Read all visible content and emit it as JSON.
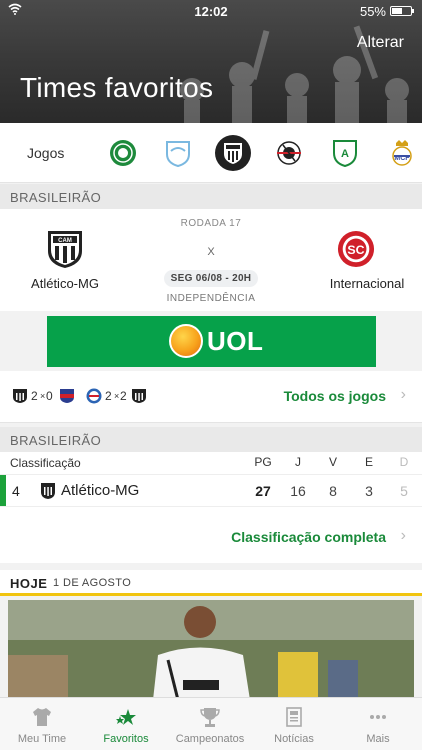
{
  "status_bar": {
    "time": "12:02",
    "battery": "55%"
  },
  "header": {
    "title": "Times favoritos",
    "edit_label": "Alterar"
  },
  "teams_row": {
    "label": "Jogos",
    "teams": [
      {
        "icon": "palmeiras-crest-icon",
        "color": "#1e8a3c"
      },
      {
        "icon": "londrina-crest-icon",
        "color": "#7ab8e0"
      },
      {
        "icon": "atletico-mg-crest-icon",
        "color": "#222222",
        "selected": true
      },
      {
        "icon": "corinthians-crest-icon",
        "color": "#d0202a"
      },
      {
        "icon": "america-mg-crest-icon",
        "color": "#1a8a3a"
      },
      {
        "icon": "real-madrid-crest-icon",
        "color": "#d4a017"
      }
    ]
  },
  "match_section": {
    "label": "BRASILEIRÃO"
  },
  "match": {
    "round": "RODADA 17",
    "vs": "X",
    "home": {
      "name": "Atlético-MG"
    },
    "away": {
      "name": "Internacional"
    },
    "datetime": "SEG 06/08 - 20H",
    "stadium": "INDEPENDÊNCIA"
  },
  "ad": {
    "brand": "UOL"
  },
  "recent_results": {
    "games": [
      {
        "home_score": "2",
        "away_score": "0",
        "sep": "×"
      },
      {
        "home_score": "2",
        "away_score": "2",
        "sep": "×"
      }
    ],
    "link_label": "Todos os jogos"
  },
  "standings_section": {
    "label": "BRASILEIRÃO"
  },
  "standings": {
    "header": {
      "title": "Classificação",
      "cols": [
        "PG",
        "J",
        "V",
        "E",
        "D"
      ]
    },
    "row": {
      "position": "4",
      "team": "Atlético-MG",
      "pg": "27",
      "j": "16",
      "v": "8",
      "e": "3",
      "d": "5"
    },
    "link_label": "Classificação completa"
  },
  "today": {
    "label": "HOJE",
    "date": "1 DE AGOSTO"
  },
  "tabbar": {
    "tabs": [
      {
        "label": "Meu Time"
      },
      {
        "label": "Favoritos",
        "active": true
      },
      {
        "label": "Campeonatos"
      },
      {
        "label": "Notícias"
      },
      {
        "label": "Mais"
      }
    ]
  },
  "colors": {
    "accent": "#1a8a3a",
    "highlight": "#f1c40f",
    "ad_bg": "#06a14a"
  }
}
